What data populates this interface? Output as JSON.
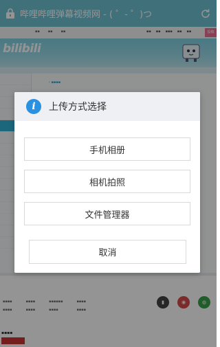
{
  "browser": {
    "title": "哔哩哔哩弹幕视频网 - ( ゜- ゜)つ",
    "lock_icon": "lock-icon",
    "reload_icon": "reload-icon"
  },
  "site": {
    "logo": "bilibili",
    "upload_label": "投稿"
  },
  "dialog": {
    "title": "上传方式选择",
    "icon": "info-icon",
    "options": [
      "手机相册",
      "相机拍照",
      "文件管理器"
    ],
    "cancel_label": "取消"
  },
  "colors": {
    "topbar": "#6fc3d4",
    "info_icon": "#2a90e0",
    "sidebar_active": "#33b1d8",
    "upload_button": "#ee6f91"
  }
}
